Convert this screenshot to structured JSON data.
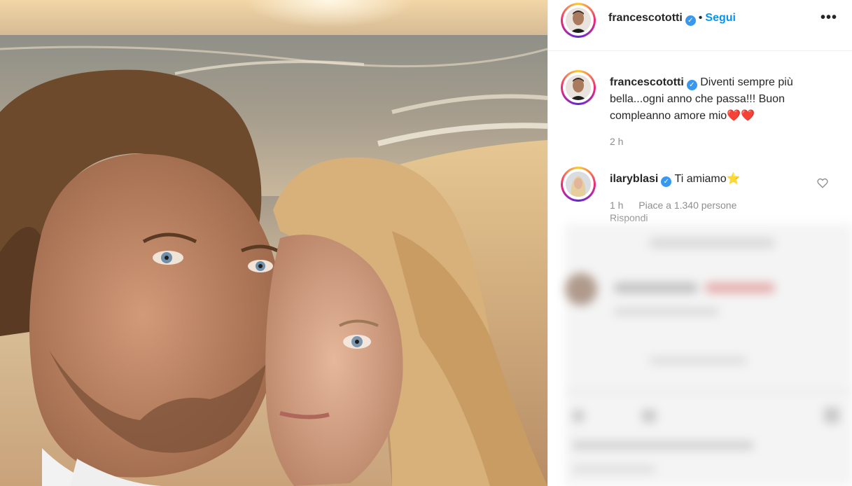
{
  "post": {
    "username": "francescototti",
    "follow_label": "Segui",
    "separator": "•",
    "more_label": "•••",
    "verified_glyph": "✓"
  },
  "caption": {
    "username": "francescototti",
    "text_line1": "Diventi sempre più",
    "text_line2": "bella...ogni anno che passa!!! Buon",
    "text_line3": "compleanno amore mio",
    "hearts": "❤️❤️",
    "time": "2 h"
  },
  "comment": {
    "username": "ilaryblasi",
    "text": "Ti amiamo",
    "emoji": "⭐",
    "time": "1 h",
    "likes": "Piace a 1.340 persone",
    "reply": "Rispondi"
  },
  "colors": {
    "accent": "#0095f6",
    "verified": "#3897f0",
    "text": "#262626",
    "muted": "#8e8e8e",
    "heart": "#ed4956"
  },
  "icons": {
    "verified": "verified-badge-icon",
    "like": "heart-outline-icon",
    "more": "more-options-icon"
  }
}
